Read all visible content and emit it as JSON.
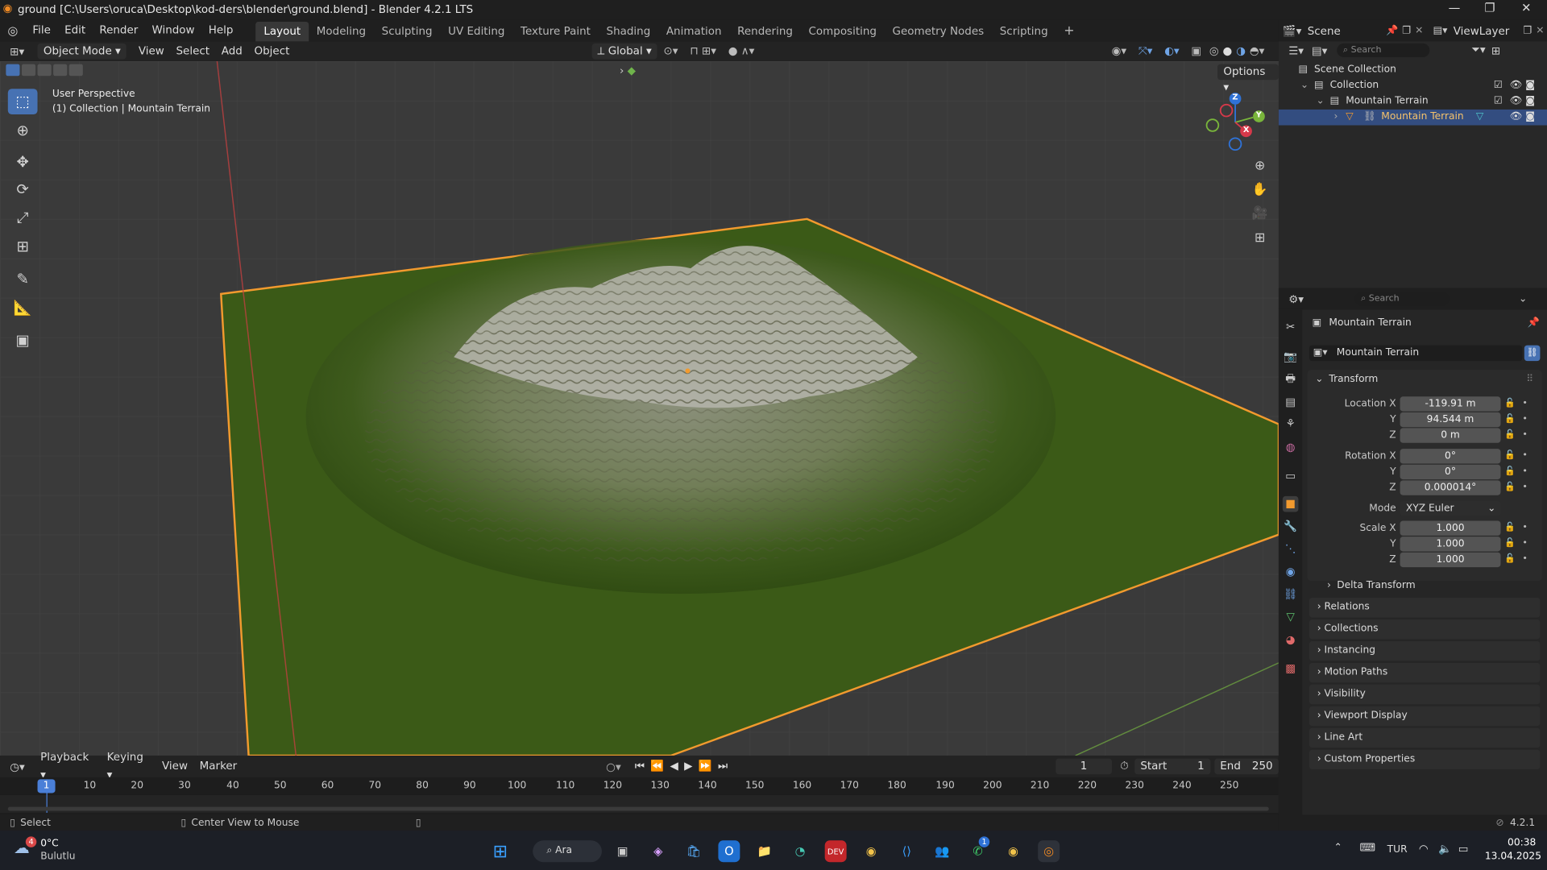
{
  "window": {
    "title": "ground [C:\\Users\\oruca\\Desktop\\kod-ders\\blender\\ground.blend] - Blender 4.2.1 LTS"
  },
  "menu": {
    "items": [
      "File",
      "Edit",
      "Render",
      "Window",
      "Help"
    ]
  },
  "workspaces": [
    "Layout",
    "Modeling",
    "Sculpting",
    "UV Editing",
    "Texture Paint",
    "Shading",
    "Animation",
    "Rendering",
    "Compositing",
    "Geometry Nodes",
    "Scripting"
  ],
  "active_workspace": "Layout",
  "topright": {
    "scene": "Scene",
    "view_layer": "ViewLayer"
  },
  "viewport_header": {
    "mode": "Object Mode",
    "menus": [
      "View",
      "Select",
      "Add",
      "Object"
    ],
    "transform_orientation": "Global",
    "options": "Options"
  },
  "viewport": {
    "perspective": "User Perspective",
    "collection_info": "(1) Collection | Mountain Terrain",
    "gizmo_labels": {
      "z": "Z",
      "y": "Y",
      "x": "X"
    }
  },
  "timeline": {
    "menus": [
      "Playback",
      "Keying",
      "View",
      "Marker"
    ],
    "current_frame": "1",
    "start_label": "Start",
    "start": "1",
    "end_label": "End",
    "end": "250",
    "ticks": [
      "1",
      "10",
      "20",
      "30",
      "40",
      "50",
      "60",
      "70",
      "80",
      "90",
      "100",
      "110",
      "120",
      "130",
      "140",
      "150",
      "160",
      "170",
      "180",
      "190",
      "200",
      "210",
      "220",
      "230",
      "240",
      "250"
    ]
  },
  "status": {
    "left": "Select",
    "middle": "Center View to Mouse",
    "version": "4.2.1"
  },
  "outliner": {
    "search_placeholder": "Search",
    "rows": [
      "Scene Collection",
      "Collection",
      "Mountain Terrain",
      "Mountain Terrain"
    ]
  },
  "properties": {
    "search_placeholder": "Search",
    "object_name": "Mountain Terrain",
    "datablock_name": "Mountain Terrain",
    "transform_title": "Transform",
    "location_label": "Location X",
    "location": [
      "-119.91 m",
      "94.544 m",
      "0 m"
    ],
    "rotation_label": "Rotation X",
    "rotation": [
      "0°",
      "0°",
      "0.000014°"
    ],
    "mode_label": "Mode",
    "mode_value": "XYZ Euler",
    "scale_label": "Scale X",
    "scale": [
      "1.000",
      "1.000",
      "1.000"
    ],
    "axis_y": "Y",
    "axis_z": "Z",
    "delta": "Delta Transform",
    "sections": [
      "Relations",
      "Collections",
      "Instancing",
      "Motion Paths",
      "Visibility",
      "Viewport Display",
      "Line Art",
      "Custom Properties"
    ]
  },
  "taskbar": {
    "weather_temp": "0°C",
    "weather_desc": "Bulutlu",
    "weather_badge": "4",
    "search": "Ara",
    "lang": "TUR",
    "time": "00:38",
    "date": "13.04.2025",
    "teams_badge": "1"
  }
}
